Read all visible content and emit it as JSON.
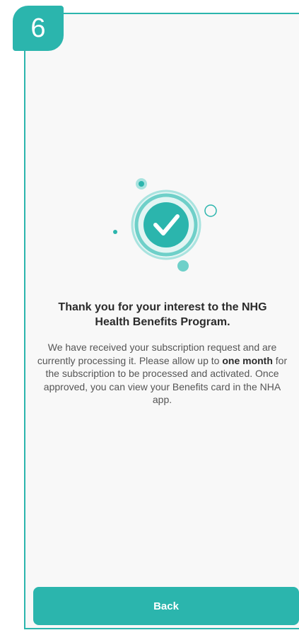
{
  "step": {
    "number": "6"
  },
  "confirmation": {
    "heading": "Thank you for your interest to the NHG Health Benefits Program.",
    "message_before": "We have received your subscription request and are currently processing it. Please allow up to ",
    "message_bold": "one month",
    "message_after": " for the subscription to be processed and activated. Once approved, you can view your Benefits card in the NHA app."
  },
  "actions": {
    "back_label": "Back"
  },
  "colors": {
    "accent": "#2bb5ad",
    "accent_light": "#a9e3df",
    "background": "#f8f8f8"
  },
  "icons": {
    "success": "check-circle-icon"
  }
}
